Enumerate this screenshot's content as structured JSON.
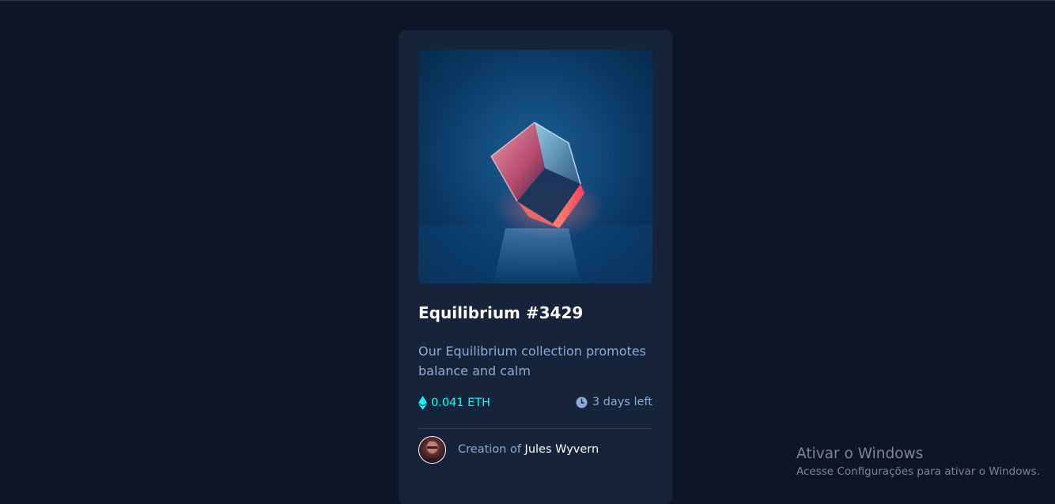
{
  "card": {
    "image_alt": "Equilibrium cube",
    "title": "Equilibrium #3429",
    "description": "Our Equilibrium collection promotes balance and calm",
    "price": "0.041 ETH",
    "time_left": "3 days left",
    "creator_prefix": "Creation of",
    "creator_name": "Jules Wyvern",
    "icons": {
      "price": "ethereum-icon",
      "time": "clock-icon"
    }
  },
  "watermark": {
    "title": "Ativar o Windows",
    "subtitle": "Acesse Configurações para ativar o Windows."
  },
  "colors": {
    "page_bg": "#0d1629",
    "card_bg": "#15233b",
    "accent_cyan": "#00fff8",
    "soft_blue": "#8bacd9",
    "white": "#ffffff"
  }
}
